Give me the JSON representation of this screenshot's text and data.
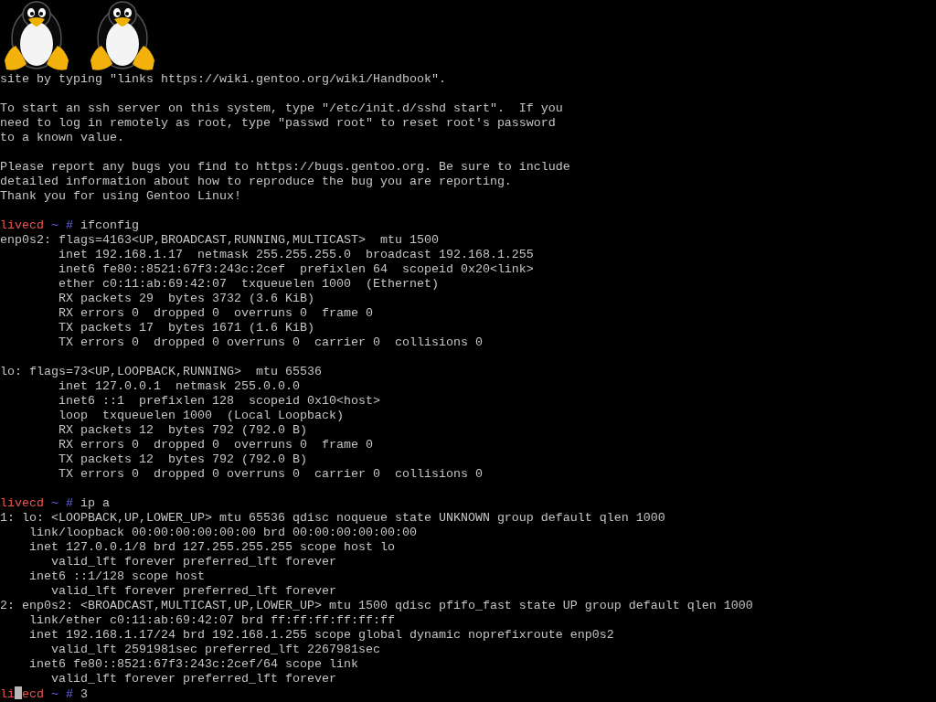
{
  "logos": [
    {
      "kind": "penguin"
    },
    {
      "kind": "penguin"
    }
  ],
  "lines": [
    {
      "kind": "text",
      "text": "site by typing \"links https://wiki.gentoo.org/wiki/Handbook\"."
    },
    {
      "kind": "blank"
    },
    {
      "kind": "text",
      "text": "To start an ssh server on this system, type \"/etc/init.d/sshd start\".  If you"
    },
    {
      "kind": "text",
      "text": "need to log in remotely as root, type \"passwd root\" to reset root's password"
    },
    {
      "kind": "text",
      "text": "to a known value."
    },
    {
      "kind": "blank"
    },
    {
      "kind": "text",
      "text": "Please report any bugs you find to https://bugs.gentoo.org. Be sure to include"
    },
    {
      "kind": "text",
      "text": "detailed information about how to reproduce the bug you are reporting."
    },
    {
      "kind": "text",
      "text": "Thank you for using Gentoo Linux!"
    },
    {
      "kind": "blank"
    },
    {
      "kind": "prompt",
      "host": "livecd",
      "cursor": false,
      "path": "~",
      "symbol": "#",
      "command": "ifconfig"
    },
    {
      "kind": "text",
      "text": "enp0s2: flags=4163<UP,BROADCAST,RUNNING,MULTICAST>  mtu 1500"
    },
    {
      "kind": "text",
      "text": "        inet 192.168.1.17  netmask 255.255.255.0  broadcast 192.168.1.255"
    },
    {
      "kind": "text",
      "text": "        inet6 fe80::8521:67f3:243c:2cef  prefixlen 64  scopeid 0x20<link>"
    },
    {
      "kind": "text",
      "text": "        ether c0:11:ab:69:42:07  txqueuelen 1000  (Ethernet)"
    },
    {
      "kind": "text",
      "text": "        RX packets 29  bytes 3732 (3.6 KiB)"
    },
    {
      "kind": "text",
      "text": "        RX errors 0  dropped 0  overruns 0  frame 0"
    },
    {
      "kind": "text",
      "text": "        TX packets 17  bytes 1671 (1.6 KiB)"
    },
    {
      "kind": "text",
      "text": "        TX errors 0  dropped 0 overruns 0  carrier 0  collisions 0"
    },
    {
      "kind": "blank"
    },
    {
      "kind": "text",
      "text": "lo: flags=73<UP,LOOPBACK,RUNNING>  mtu 65536"
    },
    {
      "kind": "text",
      "text": "        inet 127.0.0.1  netmask 255.0.0.0"
    },
    {
      "kind": "text",
      "text": "        inet6 ::1  prefixlen 128  scopeid 0x10<host>"
    },
    {
      "kind": "text",
      "text": "        loop  txqueuelen 1000  (Local Loopback)"
    },
    {
      "kind": "text",
      "text": "        RX packets 12  bytes 792 (792.0 B)"
    },
    {
      "kind": "text",
      "text": "        RX errors 0  dropped 0  overruns 0  frame 0"
    },
    {
      "kind": "text",
      "text": "        TX packets 12  bytes 792 (792.0 B)"
    },
    {
      "kind": "text",
      "text": "        TX errors 0  dropped 0 overruns 0  carrier 0  collisions 0"
    },
    {
      "kind": "blank"
    },
    {
      "kind": "prompt",
      "host": "livecd",
      "cursor": false,
      "path": "~",
      "symbol": "#",
      "command": "ip a"
    },
    {
      "kind": "text",
      "text": "1: lo: <LOOPBACK,UP,LOWER_UP> mtu 65536 qdisc noqueue state UNKNOWN group default qlen 1000"
    },
    {
      "kind": "text",
      "text": "    link/loopback 00:00:00:00:00:00 brd 00:00:00:00:00:00"
    },
    {
      "kind": "text",
      "text": "    inet 127.0.0.1/8 brd 127.255.255.255 scope host lo"
    },
    {
      "kind": "text",
      "text": "       valid_lft forever preferred_lft forever"
    },
    {
      "kind": "text",
      "text": "    inet6 ::1/128 scope host"
    },
    {
      "kind": "text",
      "text": "       valid_lft forever preferred_lft forever"
    },
    {
      "kind": "text",
      "text": "2: enp0s2: <BROADCAST,MULTICAST,UP,LOWER_UP> mtu 1500 qdisc pfifo_fast state UP group default qlen 1000"
    },
    {
      "kind": "text",
      "text": "    link/ether c0:11:ab:69:42:07 brd ff:ff:ff:ff:ff:ff"
    },
    {
      "kind": "text",
      "text": "    inet 192.168.1.17/24 brd 192.168.1.255 scope global dynamic noprefixroute enp0s2"
    },
    {
      "kind": "text",
      "text": "       valid_lft 2591981sec preferred_lft 2267981sec"
    },
    {
      "kind": "text",
      "text": "    inet6 fe80::8521:67f3:243c:2cef/64 scope link"
    },
    {
      "kind": "text",
      "text": "       valid_lft forever preferred_lft forever"
    },
    {
      "kind": "prompt",
      "host": "li",
      "cursor": true,
      "host_after_cursor": "ecd",
      "path": "~",
      "symbol": "#",
      "command": "3"
    }
  ]
}
